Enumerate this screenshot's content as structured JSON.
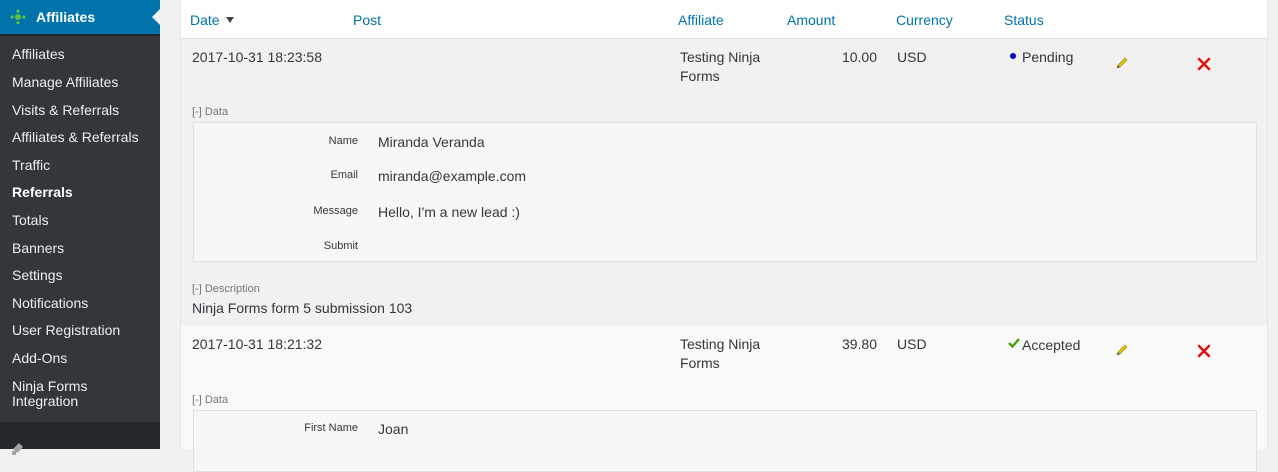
{
  "sidebar": {
    "header_label": "Affiliates",
    "header_icon": "affiliates-icon",
    "items": [
      {
        "label": "Affiliates"
      },
      {
        "label": "Manage Affiliates"
      },
      {
        "label": "Visits & Referrals"
      },
      {
        "label": "Affiliates & Referrals"
      },
      {
        "label": "Traffic"
      },
      {
        "label": "Referrals",
        "current": true
      },
      {
        "label": "Totals"
      },
      {
        "label": "Banners"
      },
      {
        "label": "Settings"
      },
      {
        "label": "Notifications"
      },
      {
        "label": "User Registration"
      },
      {
        "label": "Add-Ons"
      },
      {
        "label": "Ninja Forms Integration"
      }
    ],
    "bottom_icon": "appearance-icon"
  },
  "table": {
    "columns": {
      "date": "Date",
      "post": "Post",
      "affiliate": "Affiliate",
      "amount": "Amount",
      "currency": "Currency",
      "status": "Status"
    },
    "rows": [
      {
        "date": "2017-10-31 18:23:58",
        "affiliate_line1": "Testing Ninja",
        "affiliate_line2": "Forms",
        "amount": "10.00",
        "currency": "USD",
        "status": "Pending",
        "data_toggle": "[-] Data",
        "fields": [
          {
            "label": "Name",
            "value": "Miranda Veranda"
          },
          {
            "label": "Email",
            "value": "miranda@example.com"
          },
          {
            "label": "Message",
            "value": "Hello, I'm a new lead :)"
          },
          {
            "label": "Submit",
            "value": ""
          }
        ],
        "description_toggle": "[-] Description",
        "description": "Ninja Forms form 5 submission 103"
      },
      {
        "date": "2017-10-31 18:21:32",
        "affiliate_line1": "Testing Ninja",
        "affiliate_line2": "Forms",
        "amount": "39.80",
        "currency": "USD",
        "status": "Accepted",
        "data_toggle": "[-] Data",
        "fields": [
          {
            "label": "First Name",
            "value": "Joan"
          }
        ]
      }
    ]
  },
  "colors": {
    "link": "#0073aa",
    "pending_dot": "#0000cc",
    "accepted_check": "#46a00c",
    "remove_x": "#dd1111",
    "edit_pencil": "#e8c300"
  }
}
